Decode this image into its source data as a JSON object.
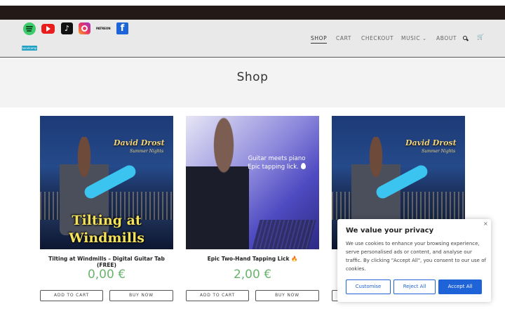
{
  "social": {
    "spotify": "spotify-icon",
    "youtube": "youtube-icon",
    "tiktok": "tiktok-icon",
    "instagram": "instagram-icon",
    "patreon_label": "PATREON",
    "facebook": "facebook-icon",
    "bandcamp_label": "bandcamp"
  },
  "nav": {
    "items": [
      {
        "label": "SHOP"
      },
      {
        "label": "CART"
      },
      {
        "label": "CHECKOUT"
      },
      {
        "label": "MUSIC"
      },
      {
        "label": "ABOUT"
      }
    ]
  },
  "page": {
    "title": "Shop"
  },
  "products": [
    {
      "title": "Tilting at Windmills – Digital Guitar Tab (FREE)",
      "price": "0,00 €",
      "image_artist": "David Drost",
      "image_album": "Summer Nights",
      "image_big_line1": "Tilting at",
      "image_big_line2": "Windmills",
      "add_label": "ADD TO CART",
      "buy_label": "BUY NOW"
    },
    {
      "title": "Epic Two-Hand Tapping Lick 🔥",
      "price": "2,00 €",
      "image_line1": "Guitar meets piano",
      "image_line2": "Epic tapping lick.",
      "add_label": "ADD TO CART",
      "buy_label": "BUY NOW"
    },
    {
      "title": "",
      "price": "",
      "image_artist": "David Drost",
      "image_album": "Summer Nights",
      "add_label": "",
      "buy_label": ""
    }
  ],
  "cookie": {
    "title": "We value your privacy",
    "body": "We use cookies to enhance your browsing experience, serve personalised ads or content, and analyse our traffic. By clicking \"Accept All\", you consent to our use of cookies.",
    "close": "×",
    "customise": "Customise",
    "reject": "Reject All",
    "accept": "Accept All"
  },
  "colors": {
    "price_green": "#6ab36e",
    "accent_blue": "#1e63d8",
    "topbar": "#231a17"
  }
}
